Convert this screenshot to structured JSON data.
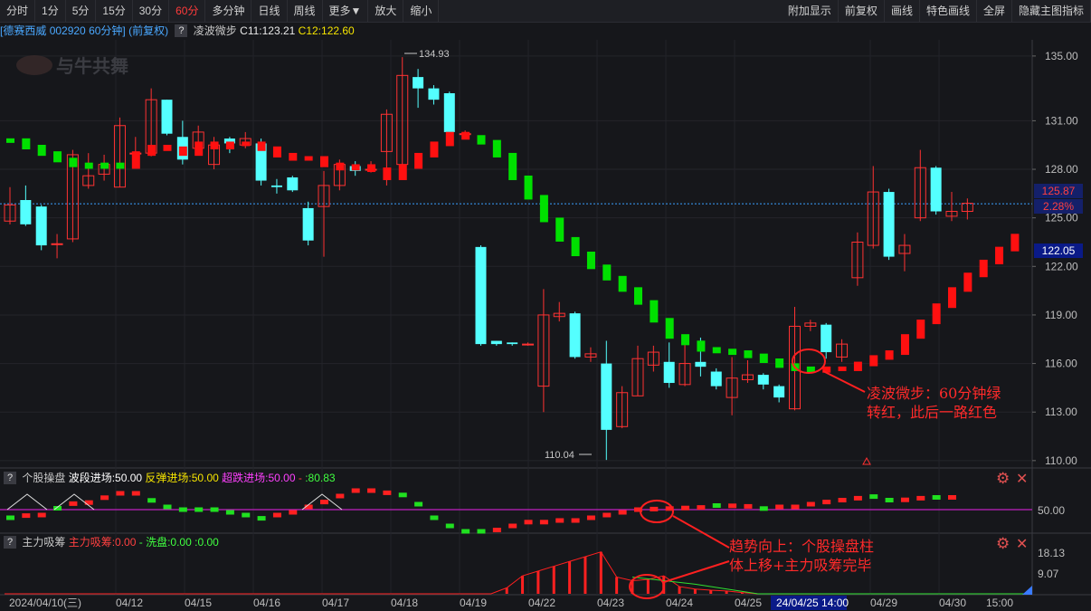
{
  "toolbar": {
    "left": [
      "分时",
      "1分",
      "5分",
      "15分",
      "30分",
      "60分",
      "多分钟",
      "日线",
      "周线",
      "更多▼",
      "放大",
      "缩小"
    ],
    "active": "60分",
    "right": [
      "附加显示",
      "前复权",
      "画线",
      "特色画线",
      "全屏",
      "隐藏主图指标"
    ]
  },
  "stock": {
    "name": "[德赛西威",
    "code": "002920",
    "period": "60分钟]",
    "adjust": "(前复权)"
  },
  "indicator": {
    "name": "凌波微步",
    "c11": "C11:123.21",
    "c12": "C12:122.60"
  },
  "watermark": "与牛共舞",
  "price_axis": {
    "ticks": [
      "135.00",
      "131.00",
      "128.00",
      "125.00",
      "122.00",
      "119.00",
      "116.00",
      "113.00",
      "110.00"
    ]
  },
  "price_tags": {
    "last": "125.87",
    "change": "2.28%",
    "c12": "122.05"
  },
  "extremes": {
    "high": "134.93",
    "low": "110.04"
  },
  "sub1": {
    "name": "个股操盘",
    "l1": "波段进场:50.00",
    "l2": "反弹进场:50.00",
    "l3": "超跌进场:50.00",
    "l4": ":80.83",
    "tick": "50.00"
  },
  "sub2": {
    "name": "主力吸筹",
    "l1": "主力吸筹:0.00",
    "l2": "洗盘:0.00",
    "l3": ":0.00",
    "tick1": "18.13",
    "tick2": "9.07"
  },
  "date_axis": [
    "2024/04/10(三)",
    "04/12",
    "04/15",
    "04/16",
    "04/17",
    "04/18",
    "04/19",
    "04/22",
    "04/23",
    "04/24",
    "04/25",
    "24/04/25 14:00",
    "04/29",
    "04/30",
    "15:00"
  ],
  "annotations": {
    "a1_line1": "凌波微步：60分钟绿",
    "a1_line2": "转红，此后一路红色",
    "a2_line1": "趋势向上：个股操盘柱",
    "a2_line2": "体上移+主力吸筹完毕"
  },
  "colors": {
    "up": "#ff3232",
    "down": "#54ffff",
    "line_green": "#00e000",
    "line_red": "#ff1010",
    "magenta": "#c020c0"
  },
  "chart_data": {
    "type": "candlestick",
    "ylim": [
      109.6,
      136.0
    ],
    "candles": [
      [
        124.8,
        125.8,
        126.9,
        124.6
      ],
      [
        126.1,
        124.6,
        127.0,
        124.5
      ],
      [
        125.7,
        123.3,
        125.8,
        123.0
      ],
      [
        123.4,
        123.4,
        124.0,
        122.5
      ],
      [
        123.7,
        128.9,
        129.2,
        123.5
      ],
      [
        127.0,
        127.6,
        129.0,
        126.8
      ],
      [
        127.7,
        128.3,
        128.9,
        127.3
      ],
      [
        126.9,
        130.7,
        131.2,
        126.9
      ],
      [
        129.0,
        129.0,
        130.0,
        128.2
      ],
      [
        129.0,
        132.3,
        133.0,
        128.8
      ],
      [
        132.3,
        130.2,
        132.3,
        130.1
      ],
      [
        130.0,
        128.6,
        131.0,
        128.3
      ],
      [
        129.3,
        130.3,
        130.7,
        129.0
      ],
      [
        128.3,
        129.5,
        130.0,
        128.0
      ],
      [
        129.9,
        129.6,
        130.0,
        129.0
      ],
      [
        129.5,
        129.9,
        130.3,
        129.3
      ],
      [
        129.6,
        127.3,
        129.9,
        127.0
      ],
      [
        127.0,
        126.9,
        127.4,
        126.5
      ],
      [
        127.5,
        126.7,
        127.6,
        126.6
      ],
      [
        125.6,
        123.6,
        126.0,
        123.3
      ],
      [
        125.7,
        127.0,
        127.9,
        122.6
      ],
      [
        127.0,
        128.3,
        128.6,
        126.7
      ],
      [
        128.2,
        127.9,
        128.5,
        127.6
      ],
      [
        128.0,
        128.0,
        128.5,
        127.8
      ],
      [
        129.1,
        131.4,
        131.7,
        127.0
      ],
      [
        128.3,
        133.8,
        134.93,
        128.0
      ],
      [
        133.7,
        133.0,
        134.2,
        131.8
      ],
      [
        133.0,
        132.3,
        133.2,
        132.0
      ],
      [
        132.7,
        130.3,
        132.8,
        130.1
      ],
      [
        130.2,
        130.2,
        130.4,
        130.0
      ],
      [
        123.2,
        117.2,
        123.3,
        117.1
      ],
      [
        117.4,
        117.2,
        117.4,
        117.1
      ],
      [
        117.3,
        117.2,
        117.3,
        117.1
      ],
      [
        117.2,
        117.2,
        117.3,
        117.1
      ],
      [
        114.6,
        119.0,
        120.6,
        113.0
      ],
      [
        118.9,
        119.1,
        119.8,
        118.6
      ],
      [
        119.1,
        116.4,
        119.2,
        116.3
      ],
      [
        116.4,
        116.6,
        117.0,
        116.1
      ],
      [
        116.0,
        111.9,
        117.4,
        110.04
      ],
      [
        112.1,
        114.2,
        114.6,
        112.0
      ],
      [
        114.0,
        116.3,
        117.1,
        114.0
      ],
      [
        115.9,
        116.7,
        117.1,
        115.5
      ],
      [
        116.1,
        114.8,
        117.3,
        114.5
      ],
      [
        114.7,
        116.0,
        117.4,
        114.6
      ],
      [
        116.1,
        115.8,
        117.6,
        115.2
      ],
      [
        115.5,
        114.6,
        115.7,
        114.4
      ],
      [
        113.9,
        115.1,
        116.4,
        112.8
      ],
      [
        115.0,
        115.3,
        116.2,
        114.8
      ],
      [
        115.3,
        114.7,
        115.4,
        114.4
      ],
      [
        114.6,
        113.9,
        114.7,
        113.6
      ],
      [
        113.2,
        118.3,
        119.5,
        113.1
      ],
      [
        118.3,
        118.5,
        118.7,
        118.0
      ],
      [
        118.4,
        116.7,
        118.5,
        116.3
      ],
      [
        116.4,
        117.2,
        117.5,
        116.1
      ],
      [
        121.3,
        123.5,
        124.1,
        120.8
      ],
      [
        123.3,
        126.6,
        128.2,
        123.1
      ],
      [
        126.6,
        122.6,
        126.8,
        122.4
      ],
      [
        122.8,
        123.3,
        124.0,
        121.7
      ],
      [
        125.0,
        128.1,
        129.2,
        124.8
      ],
      [
        128.1,
        125.4,
        128.2,
        125.2
      ],
      [
        125.1,
        125.4,
        126.6,
        124.8
      ],
      [
        125.4,
        125.9,
        126.2,
        124.9
      ]
    ],
    "lingbo": [
      129.8,
      129.4,
      129.0,
      128.6,
      128.3,
      128.2,
      128.3,
      128.2,
      129.0,
      129.4,
      129.3,
      129.0,
      129.6,
      129.4,
      129.6,
      129.6,
      129.3,
      128.9,
      128.7,
      128.7,
      128.3,
      128.1,
      128.2,
      128.0,
      127.5,
      128.2,
      128.9,
      129.6,
      130.2,
      130.0,
      129.7,
      128.9,
      127.5,
      126.3,
      124.9,
      123.7,
      122.8,
      122.0,
      121.3,
      120.6,
      119.8,
      118.7,
      117.7,
      117.3,
      116.9,
      116.8,
      116.7,
      116.5,
      116.2,
      115.9,
      115.7,
      115.6,
      115.7,
      115.7,
      116.0,
      116.4,
      116.7,
      117.7,
      118.6,
      119.6,
      120.6,
      121.5,
      122.3,
      123.1,
      123.9
    ],
    "lingbo_red": [
      8,
      9,
      10,
      11,
      12,
      13,
      14,
      15,
      16,
      17,
      18,
      19,
      20,
      21,
      22,
      23,
      24,
      25,
      26,
      27,
      28,
      29,
      52,
      53,
      54,
      55,
      56,
      57,
      58,
      59,
      60,
      61,
      62,
      63,
      64
    ],
    "sub1_blocks": [
      [
        -0.3,
        "g"
      ],
      [
        -0.22,
        "r"
      ],
      [
        -0.2,
        "r"
      ],
      [
        0.05,
        "g"
      ],
      [
        0.22,
        "r"
      ],
      [
        0.26,
        "r"
      ],
      [
        0.44,
        "r"
      ],
      [
        0.6,
        "r"
      ],
      [
        0.6,
        "r"
      ],
      [
        0.34,
        "g"
      ],
      [
        0.1,
        "g"
      ],
      [
        0.0,
        "g"
      ],
      [
        0.0,
        "g"
      ],
      [
        0.0,
        "g"
      ],
      [
        -0.1,
        "g"
      ],
      [
        -0.2,
        "g"
      ],
      [
        -0.32,
        "g"
      ],
      [
        -0.2,
        "r"
      ],
      [
        -0.1,
        "r"
      ],
      [
        0.1,
        "r"
      ],
      [
        0.28,
        "r"
      ],
      [
        0.5,
        "r"
      ],
      [
        0.7,
        "r"
      ],
      [
        0.7,
        "r"
      ],
      [
        0.62,
        "r"
      ],
      [
        0.54,
        "g"
      ],
      [
        0.2,
        "g"
      ],
      [
        -0.3,
        "g"
      ],
      [
        -0.6,
        "g"
      ],
      [
        -0.8,
        "g"
      ],
      [
        -0.8,
        "g"
      ],
      [
        -0.75,
        "r"
      ],
      [
        -0.6,
        "r"
      ],
      [
        -0.46,
        "r"
      ],
      [
        -0.46,
        "r"
      ],
      [
        -0.4,
        "r"
      ],
      [
        -0.4,
        "r"
      ],
      [
        -0.3,
        "r"
      ],
      [
        -0.2,
        "r"
      ],
      [
        -0.1,
        "r"
      ],
      [
        0.0,
        "r"
      ],
      [
        0.02,
        "r"
      ],
      [
        0.04,
        "r"
      ],
      [
        0.06,
        "r"
      ],
      [
        0.08,
        "r"
      ],
      [
        0.15,
        "g"
      ],
      [
        0.14,
        "r"
      ],
      [
        0.12,
        "r"
      ],
      [
        0.04,
        "g"
      ],
      [
        0.1,
        "r"
      ],
      [
        0.1,
        "r"
      ],
      [
        0.2,
        "r"
      ],
      [
        0.28,
        "r"
      ],
      [
        0.35,
        "r"
      ],
      [
        0.42,
        "r"
      ],
      [
        0.48,
        "g"
      ],
      [
        0.35,
        "g"
      ],
      [
        0.36,
        "r"
      ],
      [
        0.42,
        "r"
      ],
      [
        0.45,
        "g"
      ],
      [
        0.45,
        "r"
      ]
    ],
    "sub2_bars": [
      0,
      0,
      0,
      0,
      0,
      0,
      0,
      0,
      0,
      0,
      0,
      0,
      0,
      0,
      0,
      0,
      0,
      0,
      0,
      0,
      0,
      0,
      0,
      0,
      0,
      0,
      0,
      0,
      0,
      0,
      0,
      0,
      2.5,
      7.5,
      9.5,
      11.5,
      13.5,
      15.5,
      17.5,
      7.0,
      5.5,
      6.0,
      7.5,
      3.0,
      2.0,
      1.5,
      1.2,
      0.5,
      0,
      0,
      0,
      0,
      0,
      0,
      0,
      0,
      0,
      0,
      0,
      0,
      0,
      0,
      0,
      0,
      0
    ]
  }
}
